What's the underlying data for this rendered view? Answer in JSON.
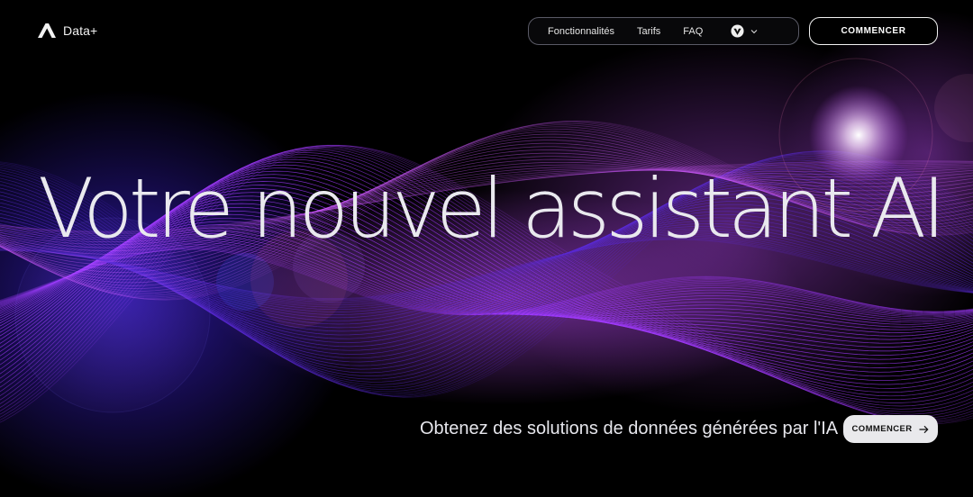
{
  "brand": {
    "name": "Data+"
  },
  "nav": {
    "items": [
      {
        "label": "Fonctionnalités"
      },
      {
        "label": "Tarifs"
      },
      {
        "label": "FAQ"
      }
    ]
  },
  "header": {
    "cta_label": "COMMENCER"
  },
  "hero": {
    "headline": "Votre nouvel assistant AI",
    "subtitle": "Obtenez des solutions de données générées par l'IA",
    "cta_label": "COMMENCER"
  },
  "icons": {
    "logo": "logo-mark-icon",
    "language": "globe-badge-icon",
    "dropdown": "chevron-down-icon",
    "cta": "arrow-right-icon"
  },
  "colors": {
    "background": "#000000",
    "accent_purple": "#a23bff",
    "accent_violet": "#5b2bd8",
    "text": "#e9e9ee",
    "cta_bg": "#e9e9ec"
  }
}
